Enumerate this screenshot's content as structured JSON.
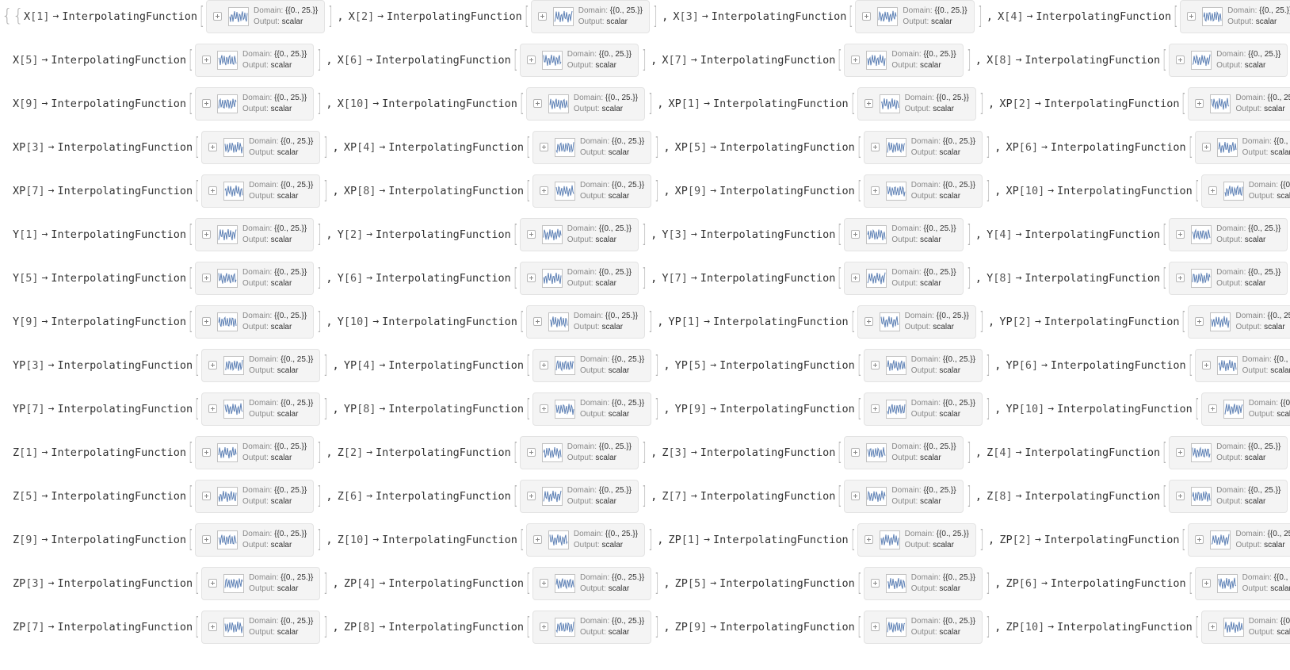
{
  "rows": [
    [
      {
        "sym": "X",
        "idx": "1"
      },
      {
        "sym": "X",
        "idx": "2"
      },
      {
        "sym": "X",
        "idx": "3"
      },
      {
        "sym": "X",
        "idx": "4"
      }
    ],
    [
      {
        "sym": "X",
        "idx": "5"
      },
      {
        "sym": "X",
        "idx": "6"
      },
      {
        "sym": "X",
        "idx": "7"
      },
      {
        "sym": "X",
        "idx": "8"
      }
    ],
    [
      {
        "sym": "X",
        "idx": "9"
      },
      {
        "sym": "X",
        "idx": "10"
      },
      {
        "sym": "XP",
        "idx": "1"
      },
      {
        "sym": "XP",
        "idx": "2"
      }
    ],
    [
      {
        "sym": "XP",
        "idx": "3"
      },
      {
        "sym": "XP",
        "idx": "4"
      },
      {
        "sym": "XP",
        "idx": "5"
      },
      {
        "sym": "XP",
        "idx": "6"
      }
    ],
    [
      {
        "sym": "XP",
        "idx": "7"
      },
      {
        "sym": "XP",
        "idx": "8"
      },
      {
        "sym": "XP",
        "idx": "9"
      },
      {
        "sym": "XP",
        "idx": "10"
      }
    ],
    [
      {
        "sym": "Y",
        "idx": "1"
      },
      {
        "sym": "Y",
        "idx": "2"
      },
      {
        "sym": "Y",
        "idx": "3"
      },
      {
        "sym": "Y",
        "idx": "4"
      }
    ],
    [
      {
        "sym": "Y",
        "idx": "5"
      },
      {
        "sym": "Y",
        "idx": "6"
      },
      {
        "sym": "Y",
        "idx": "7"
      },
      {
        "sym": "Y",
        "idx": "8"
      }
    ],
    [
      {
        "sym": "Y",
        "idx": "9"
      },
      {
        "sym": "Y",
        "idx": "10"
      },
      {
        "sym": "YP",
        "idx": "1"
      },
      {
        "sym": "YP",
        "idx": "2"
      }
    ],
    [
      {
        "sym": "YP",
        "idx": "3"
      },
      {
        "sym": "YP",
        "idx": "4"
      },
      {
        "sym": "YP",
        "idx": "5"
      },
      {
        "sym": "YP",
        "idx": "6"
      }
    ],
    [
      {
        "sym": "YP",
        "idx": "7"
      },
      {
        "sym": "YP",
        "idx": "8"
      },
      {
        "sym": "YP",
        "idx": "9"
      },
      {
        "sym": "YP",
        "idx": "10"
      }
    ],
    [
      {
        "sym": "Z",
        "idx": "1"
      },
      {
        "sym": "Z",
        "idx": "2"
      },
      {
        "sym": "Z",
        "idx": "3"
      },
      {
        "sym": "Z",
        "idx": "4"
      }
    ],
    [
      {
        "sym": "Z",
        "idx": "5"
      },
      {
        "sym": "Z",
        "idx": "6"
      },
      {
        "sym": "Z",
        "idx": "7"
      },
      {
        "sym": "Z",
        "idx": "8"
      }
    ],
    [
      {
        "sym": "Z",
        "idx": "9"
      },
      {
        "sym": "Z",
        "idx": "10"
      },
      {
        "sym": "ZP",
        "idx": "1"
      },
      {
        "sym": "ZP",
        "idx": "2"
      }
    ],
    [
      {
        "sym": "ZP",
        "idx": "3"
      },
      {
        "sym": "ZP",
        "idx": "4"
      },
      {
        "sym": "ZP",
        "idx": "5"
      },
      {
        "sym": "ZP",
        "idx": "6"
      }
    ],
    [
      {
        "sym": "ZP",
        "idx": "7"
      },
      {
        "sym": "ZP",
        "idx": "8"
      },
      {
        "sym": "ZP",
        "idx": "9"
      },
      {
        "sym": "ZP",
        "idx": "10"
      }
    ]
  ],
  "function_name": "InterpolatingFunction",
  "arrow": "→",
  "domain_label": "Domain:",
  "domain_value": "{{0., 25.}}",
  "output_label": "Output:",
  "output_value": "scalar",
  "open_braces": "{{",
  "close_braces": "}}",
  "separator": ",",
  "thumb_color": "#5e81b5",
  "icons": {
    "expand": "plus-icon",
    "thumbnail": "plot-thumbnail-icon"
  }
}
